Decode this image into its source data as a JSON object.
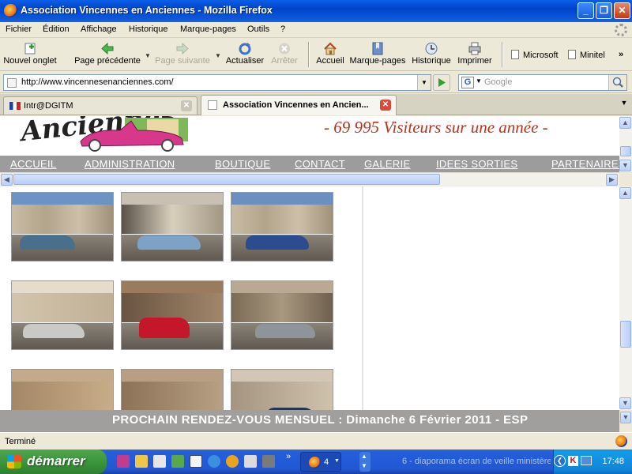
{
  "window": {
    "title": "Association Vincennes en Anciennes - Mozilla Firefox"
  },
  "menubar": {
    "items": [
      "Fichier",
      "Édition",
      "Affichage",
      "Historique",
      "Marque-pages",
      "Outils",
      "?"
    ]
  },
  "toolbar": {
    "new_tab": "Nouvel onglet",
    "back": "Page précédente",
    "forward": "Page suivante",
    "reload": "Actualiser",
    "stop": "Arrêter",
    "home": "Accueil",
    "bookmarks": "Marque-pages",
    "history": "Historique",
    "print": "Imprimer",
    "bookmark_links": [
      "Microsoft",
      "Minitel"
    ],
    "overflow": "»"
  },
  "address": {
    "url": "http://www.vincennesenanciennes.com/"
  },
  "search": {
    "placeholder": "Google",
    "engine_letter": "G"
  },
  "tabs": [
    {
      "label": "Intr@DGITM",
      "active": false
    },
    {
      "label": "Association Vincennes en Ancien...",
      "active": true
    }
  ],
  "site": {
    "logo_text": "Anciennes",
    "visitors": "- 69 995 Visiteurs sur une année -",
    "nav": [
      "ACCUEIL",
      "ADMINISTRATION",
      "BOUTIQUE",
      "CONTACT",
      "GALERIE",
      "IDEES SORTIES",
      "PARTENAIRES"
    ],
    "banner": "PROCHAIN RENDEZ-VOUS MENSUEL :   Dimanche 6 Février 2011  -  ESP"
  },
  "status": {
    "text": "Terminé"
  },
  "taskbar": {
    "start": "démarrer",
    "firefox_group_count": "4",
    "minimized_window": "6 - diaporama écran de veille ministère",
    "clock": "17:48",
    "overflow": "»"
  },
  "colors": {
    "titlebar": "#0043c8",
    "visitors_text": "#b8321c",
    "nav_strip": "#9c9c9c",
    "banner": "#a09f9d",
    "start_button": "#3c963c"
  }
}
